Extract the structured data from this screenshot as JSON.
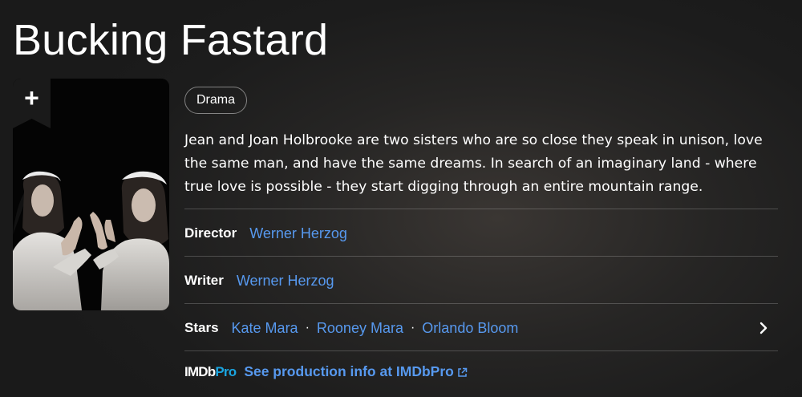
{
  "title": "Bucking Fastard",
  "watchlist": {
    "icon": "plus-icon",
    "symbol": "+"
  },
  "genres": [
    "Drama"
  ],
  "plot": "Jean and Joan Holbrooke are two sisters who are so close they speak in unison, love the same man, and have the same dreams. In search of an imaginary land - where true love is possible - they start digging through an entire mountain range.",
  "credits": {
    "director": {
      "label": "Director",
      "names": [
        "Werner Herzog"
      ]
    },
    "writer": {
      "label": "Writer",
      "names": [
        "Werner Herzog"
      ]
    },
    "stars": {
      "label": "Stars",
      "names": [
        "Kate Mara",
        "Rooney Mara",
        "Orlando Bloom"
      ],
      "separator": "·"
    }
  },
  "imdbpro": {
    "logo_imdb": "IMDb",
    "logo_pro": "Pro",
    "link_text": "See production info at IMDbPro"
  },
  "colors": {
    "link": "#5799ef",
    "pro_accent": "#1aa5e0",
    "background": "#1f1f1f",
    "text": "#ffffff"
  }
}
